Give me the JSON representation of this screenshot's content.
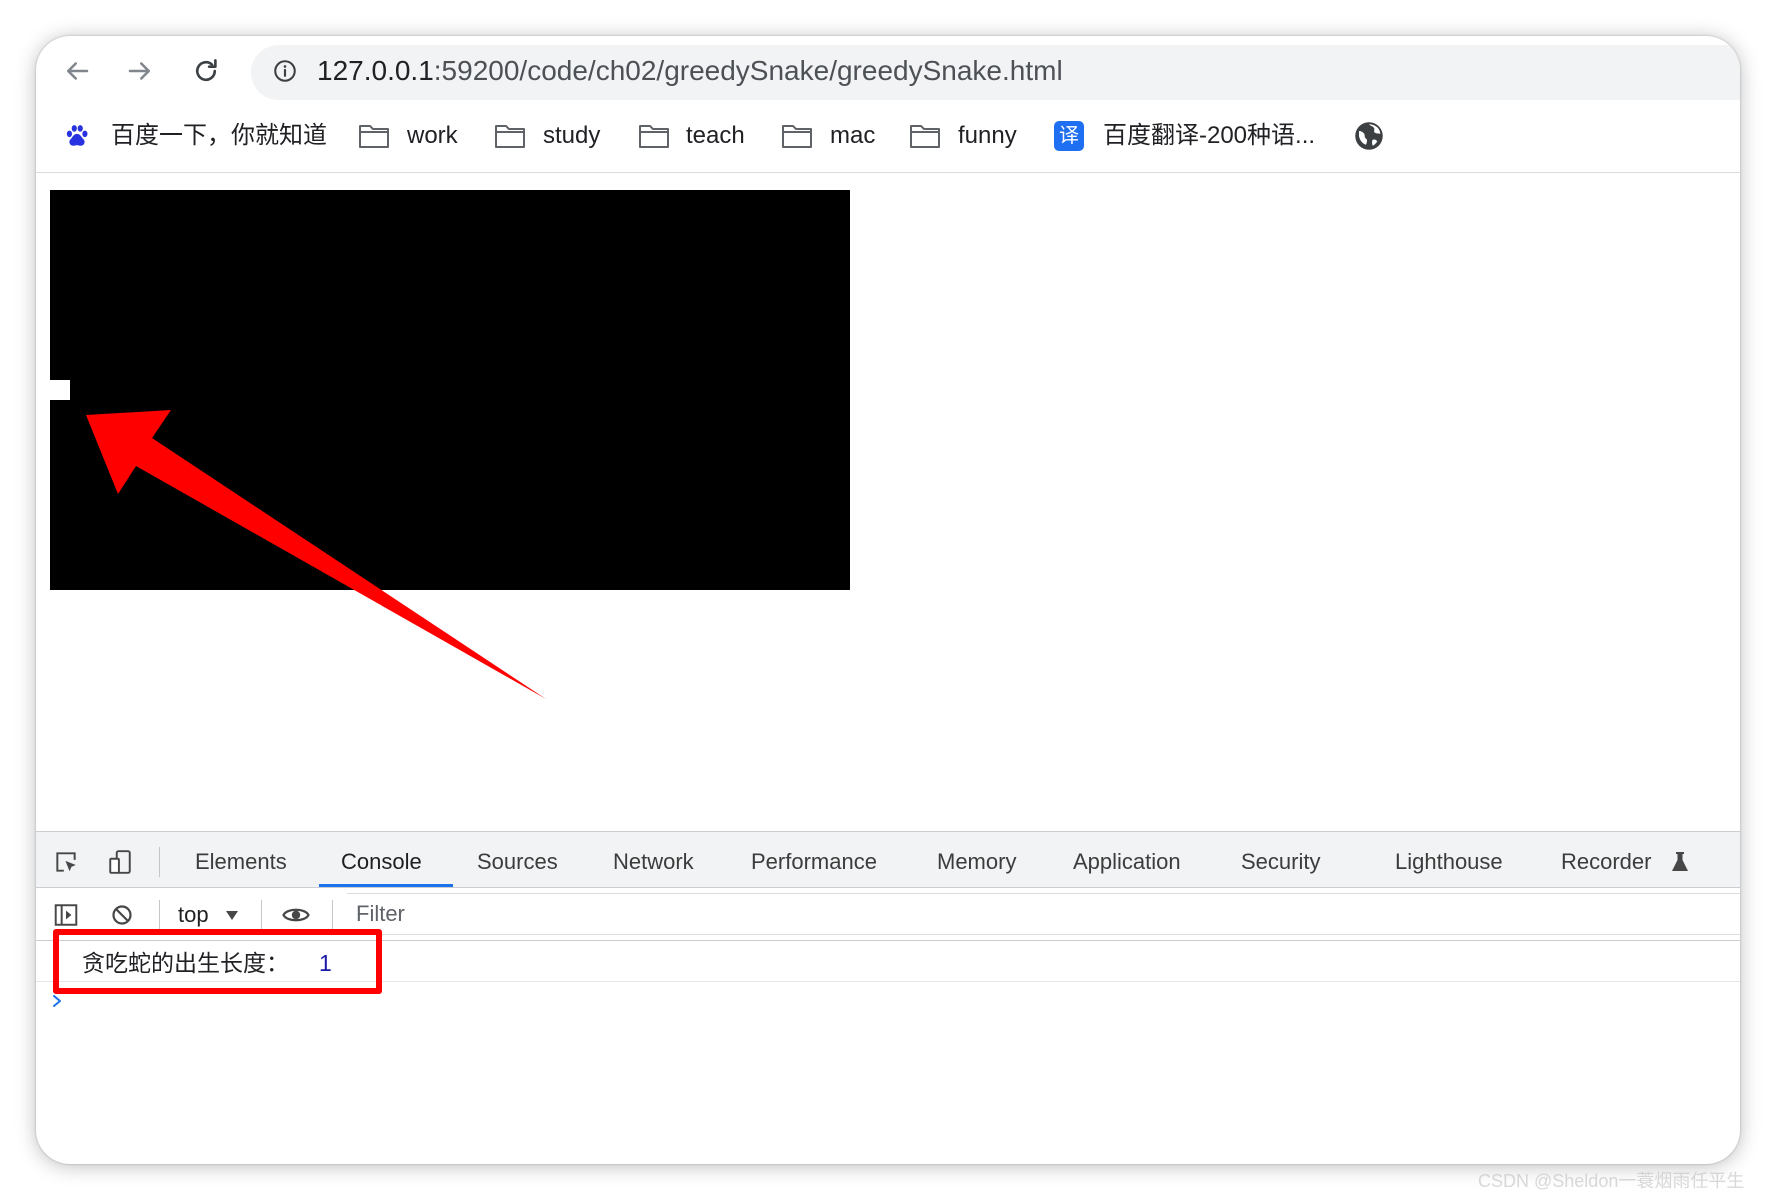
{
  "browser": {
    "url_host": "127.0.0.1",
    "url_path": ":59200/code/ch02/greedySnake/greedySnake.html",
    "nav": {
      "back_icon": "arrow-left-icon",
      "forward_icon": "arrow-right-icon",
      "reload_icon": "reload-icon",
      "site_info_icon": "info-icon"
    }
  },
  "bookmarks": [
    {
      "label": "百度一下，你就知道",
      "icon": "baidu-paw-icon"
    },
    {
      "label": "work",
      "icon": "folder-icon"
    },
    {
      "label": "study",
      "icon": "folder-icon"
    },
    {
      "label": "teach",
      "icon": "folder-icon"
    },
    {
      "label": "mac",
      "icon": "folder-icon"
    },
    {
      "label": "funny",
      "icon": "folder-icon"
    },
    {
      "label": "百度翻译-200种语...",
      "icon": "translate-icon",
      "icon_text": "译"
    },
    {
      "icon": "globe-icon"
    }
  ],
  "page": {
    "canvas_color": "#000000",
    "snake_color": "#ffffff",
    "annotation_color": "#ff0000"
  },
  "devtools": {
    "tabs": [
      {
        "label": "Elements"
      },
      {
        "label": "Console",
        "active": true
      },
      {
        "label": "Sources"
      },
      {
        "label": "Network"
      },
      {
        "label": "Performance"
      },
      {
        "label": "Memory"
      },
      {
        "label": "Application"
      },
      {
        "label": "Security"
      },
      {
        "label": "Lighthouse"
      },
      {
        "label": "Recorder",
        "icon": "flask-icon"
      }
    ],
    "context": "top",
    "filter_placeholder": "Filter",
    "console_messages": [
      {
        "text": "贪吃蛇的出生长度：",
        "value": "1"
      }
    ],
    "accent_color": "#1a73e8"
  },
  "watermark": "CSDN @Sheldon一蓑烟雨任平生"
}
